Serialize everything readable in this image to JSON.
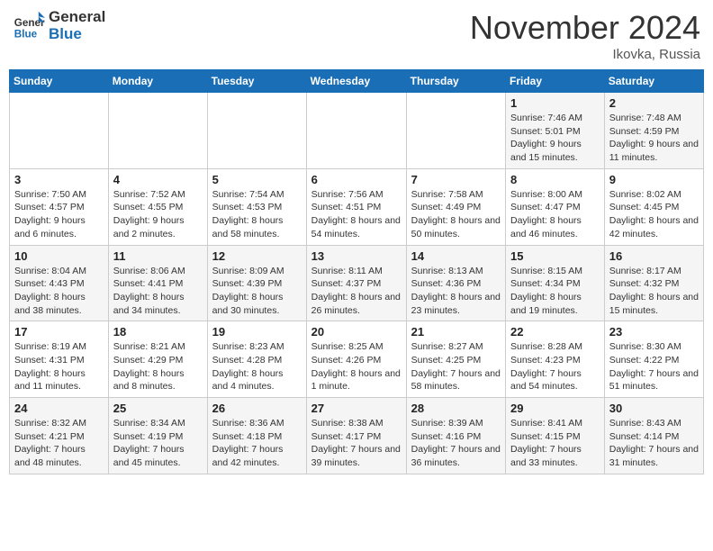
{
  "header": {
    "logo_line1": "General",
    "logo_line2": "Blue",
    "month": "November 2024",
    "location": "Ikovka, Russia"
  },
  "weekdays": [
    "Sunday",
    "Monday",
    "Tuesday",
    "Wednesday",
    "Thursday",
    "Friday",
    "Saturday"
  ],
  "weeks": [
    [
      {
        "day": "",
        "info": ""
      },
      {
        "day": "",
        "info": ""
      },
      {
        "day": "",
        "info": ""
      },
      {
        "day": "",
        "info": ""
      },
      {
        "day": "",
        "info": ""
      },
      {
        "day": "1",
        "info": "Sunrise: 7:46 AM\nSunset: 5:01 PM\nDaylight: 9 hours and 15 minutes."
      },
      {
        "day": "2",
        "info": "Sunrise: 7:48 AM\nSunset: 4:59 PM\nDaylight: 9 hours and 11 minutes."
      }
    ],
    [
      {
        "day": "3",
        "info": "Sunrise: 7:50 AM\nSunset: 4:57 PM\nDaylight: 9 hours and 6 minutes."
      },
      {
        "day": "4",
        "info": "Sunrise: 7:52 AM\nSunset: 4:55 PM\nDaylight: 9 hours and 2 minutes."
      },
      {
        "day": "5",
        "info": "Sunrise: 7:54 AM\nSunset: 4:53 PM\nDaylight: 8 hours and 58 minutes."
      },
      {
        "day": "6",
        "info": "Sunrise: 7:56 AM\nSunset: 4:51 PM\nDaylight: 8 hours and 54 minutes."
      },
      {
        "day": "7",
        "info": "Sunrise: 7:58 AM\nSunset: 4:49 PM\nDaylight: 8 hours and 50 minutes."
      },
      {
        "day": "8",
        "info": "Sunrise: 8:00 AM\nSunset: 4:47 PM\nDaylight: 8 hours and 46 minutes."
      },
      {
        "day": "9",
        "info": "Sunrise: 8:02 AM\nSunset: 4:45 PM\nDaylight: 8 hours and 42 minutes."
      }
    ],
    [
      {
        "day": "10",
        "info": "Sunrise: 8:04 AM\nSunset: 4:43 PM\nDaylight: 8 hours and 38 minutes."
      },
      {
        "day": "11",
        "info": "Sunrise: 8:06 AM\nSunset: 4:41 PM\nDaylight: 8 hours and 34 minutes."
      },
      {
        "day": "12",
        "info": "Sunrise: 8:09 AM\nSunset: 4:39 PM\nDaylight: 8 hours and 30 minutes."
      },
      {
        "day": "13",
        "info": "Sunrise: 8:11 AM\nSunset: 4:37 PM\nDaylight: 8 hours and 26 minutes."
      },
      {
        "day": "14",
        "info": "Sunrise: 8:13 AM\nSunset: 4:36 PM\nDaylight: 8 hours and 23 minutes."
      },
      {
        "day": "15",
        "info": "Sunrise: 8:15 AM\nSunset: 4:34 PM\nDaylight: 8 hours and 19 minutes."
      },
      {
        "day": "16",
        "info": "Sunrise: 8:17 AM\nSunset: 4:32 PM\nDaylight: 8 hours and 15 minutes."
      }
    ],
    [
      {
        "day": "17",
        "info": "Sunrise: 8:19 AM\nSunset: 4:31 PM\nDaylight: 8 hours and 11 minutes."
      },
      {
        "day": "18",
        "info": "Sunrise: 8:21 AM\nSunset: 4:29 PM\nDaylight: 8 hours and 8 minutes."
      },
      {
        "day": "19",
        "info": "Sunrise: 8:23 AM\nSunset: 4:28 PM\nDaylight: 8 hours and 4 minutes."
      },
      {
        "day": "20",
        "info": "Sunrise: 8:25 AM\nSunset: 4:26 PM\nDaylight: 8 hours and 1 minute."
      },
      {
        "day": "21",
        "info": "Sunrise: 8:27 AM\nSunset: 4:25 PM\nDaylight: 7 hours and 58 minutes."
      },
      {
        "day": "22",
        "info": "Sunrise: 8:28 AM\nSunset: 4:23 PM\nDaylight: 7 hours and 54 minutes."
      },
      {
        "day": "23",
        "info": "Sunrise: 8:30 AM\nSunset: 4:22 PM\nDaylight: 7 hours and 51 minutes."
      }
    ],
    [
      {
        "day": "24",
        "info": "Sunrise: 8:32 AM\nSunset: 4:21 PM\nDaylight: 7 hours and 48 minutes."
      },
      {
        "day": "25",
        "info": "Sunrise: 8:34 AM\nSunset: 4:19 PM\nDaylight: 7 hours and 45 minutes."
      },
      {
        "day": "26",
        "info": "Sunrise: 8:36 AM\nSunset: 4:18 PM\nDaylight: 7 hours and 42 minutes."
      },
      {
        "day": "27",
        "info": "Sunrise: 8:38 AM\nSunset: 4:17 PM\nDaylight: 7 hours and 39 minutes."
      },
      {
        "day": "28",
        "info": "Sunrise: 8:39 AM\nSunset: 4:16 PM\nDaylight: 7 hours and 36 minutes."
      },
      {
        "day": "29",
        "info": "Sunrise: 8:41 AM\nSunset: 4:15 PM\nDaylight: 7 hours and 33 minutes."
      },
      {
        "day": "30",
        "info": "Sunrise: 8:43 AM\nSunset: 4:14 PM\nDaylight: 7 hours and 31 minutes."
      }
    ]
  ]
}
